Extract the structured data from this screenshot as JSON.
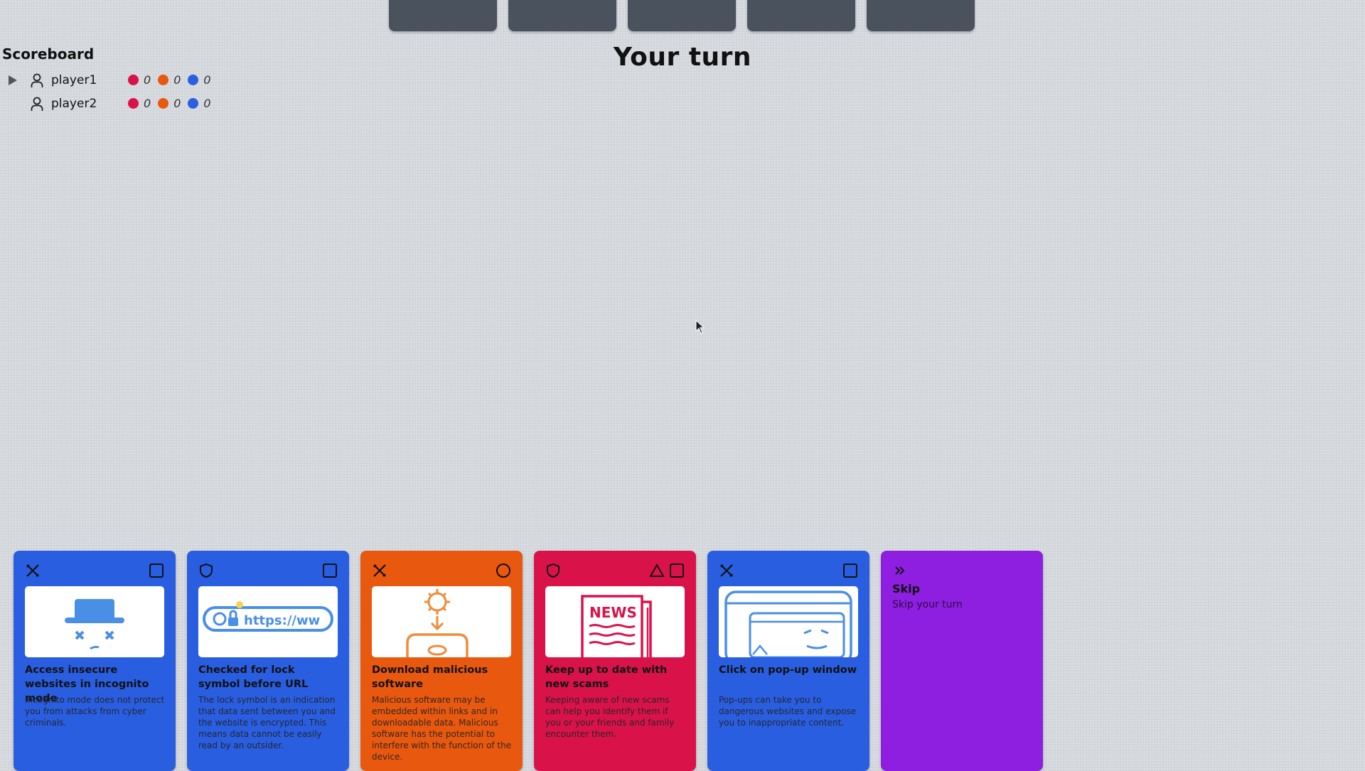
{
  "scoreboard": {
    "title": "Scoreboard",
    "players": [
      {
        "name": "player1",
        "active": true,
        "scores": [
          "0",
          "0",
          "0"
        ]
      },
      {
        "name": "player2",
        "active": false,
        "scores": [
          "0",
          "0",
          "0"
        ]
      }
    ],
    "score_colors": [
      "#d9134a",
      "#e8580f",
      "#2a5fe0"
    ]
  },
  "turn": {
    "title": "Your turn"
  },
  "opponent_cards": {
    "count": 5
  },
  "hand": [
    {
      "color": "#2a5ee0",
      "title": "Access insecure websites in incognito mode",
      "description": "Incognito mode does not protect you from attacks from cyber criminals.",
      "left_icon": "x-mark-icon",
      "right_icons": [
        "square-icon"
      ],
      "art": "incognito-hat-icon"
    },
    {
      "color": "#2a5ee0",
      "title": "Checked for lock symbol before URL",
      "description": "The lock symbol is an indication that data sent between you and the website is encrypted. This means data cannot be easily read by an outsider.",
      "left_icon": "shield-icon",
      "right_icons": [
        "square-icon"
      ],
      "art": "url-lock-icon",
      "url_text": "https://ww"
    },
    {
      "color": "#e8580f",
      "title": "Download malicious software",
      "description": "Malicious software may be embedded within links and in downloadable data. Malicious software has the potential to interfere with the function of the device.",
      "left_icon": "x-mark-icon",
      "right_icons": [
        "circle-icon"
      ],
      "art": "virus-download-icon"
    },
    {
      "color": "#d9134a",
      "title": "Keep up to date with new scams",
      "description": "Keeping aware of new scams can help you identify them if you or your friends and family encounter them.",
      "left_icon": "shield-icon",
      "right_icons": [
        "triangle-icon",
        "square-icon"
      ],
      "art": "newspaper-icon",
      "art_text": "NEWS"
    },
    {
      "color": "#2a5ee0",
      "title": "Click on pop-up window",
      "description": "Pop-ups can take you to dangerous websites and expose you to inappropriate content.",
      "left_icon": "x-mark-icon",
      "right_icons": [
        "square-icon"
      ],
      "art": "popup-window-icon"
    },
    {
      "color": "#8f1fe0",
      "title": "Skip",
      "description": "Skip your turn",
      "left_icon": "double-chevron-icon",
      "right_icons": []
    }
  ]
}
